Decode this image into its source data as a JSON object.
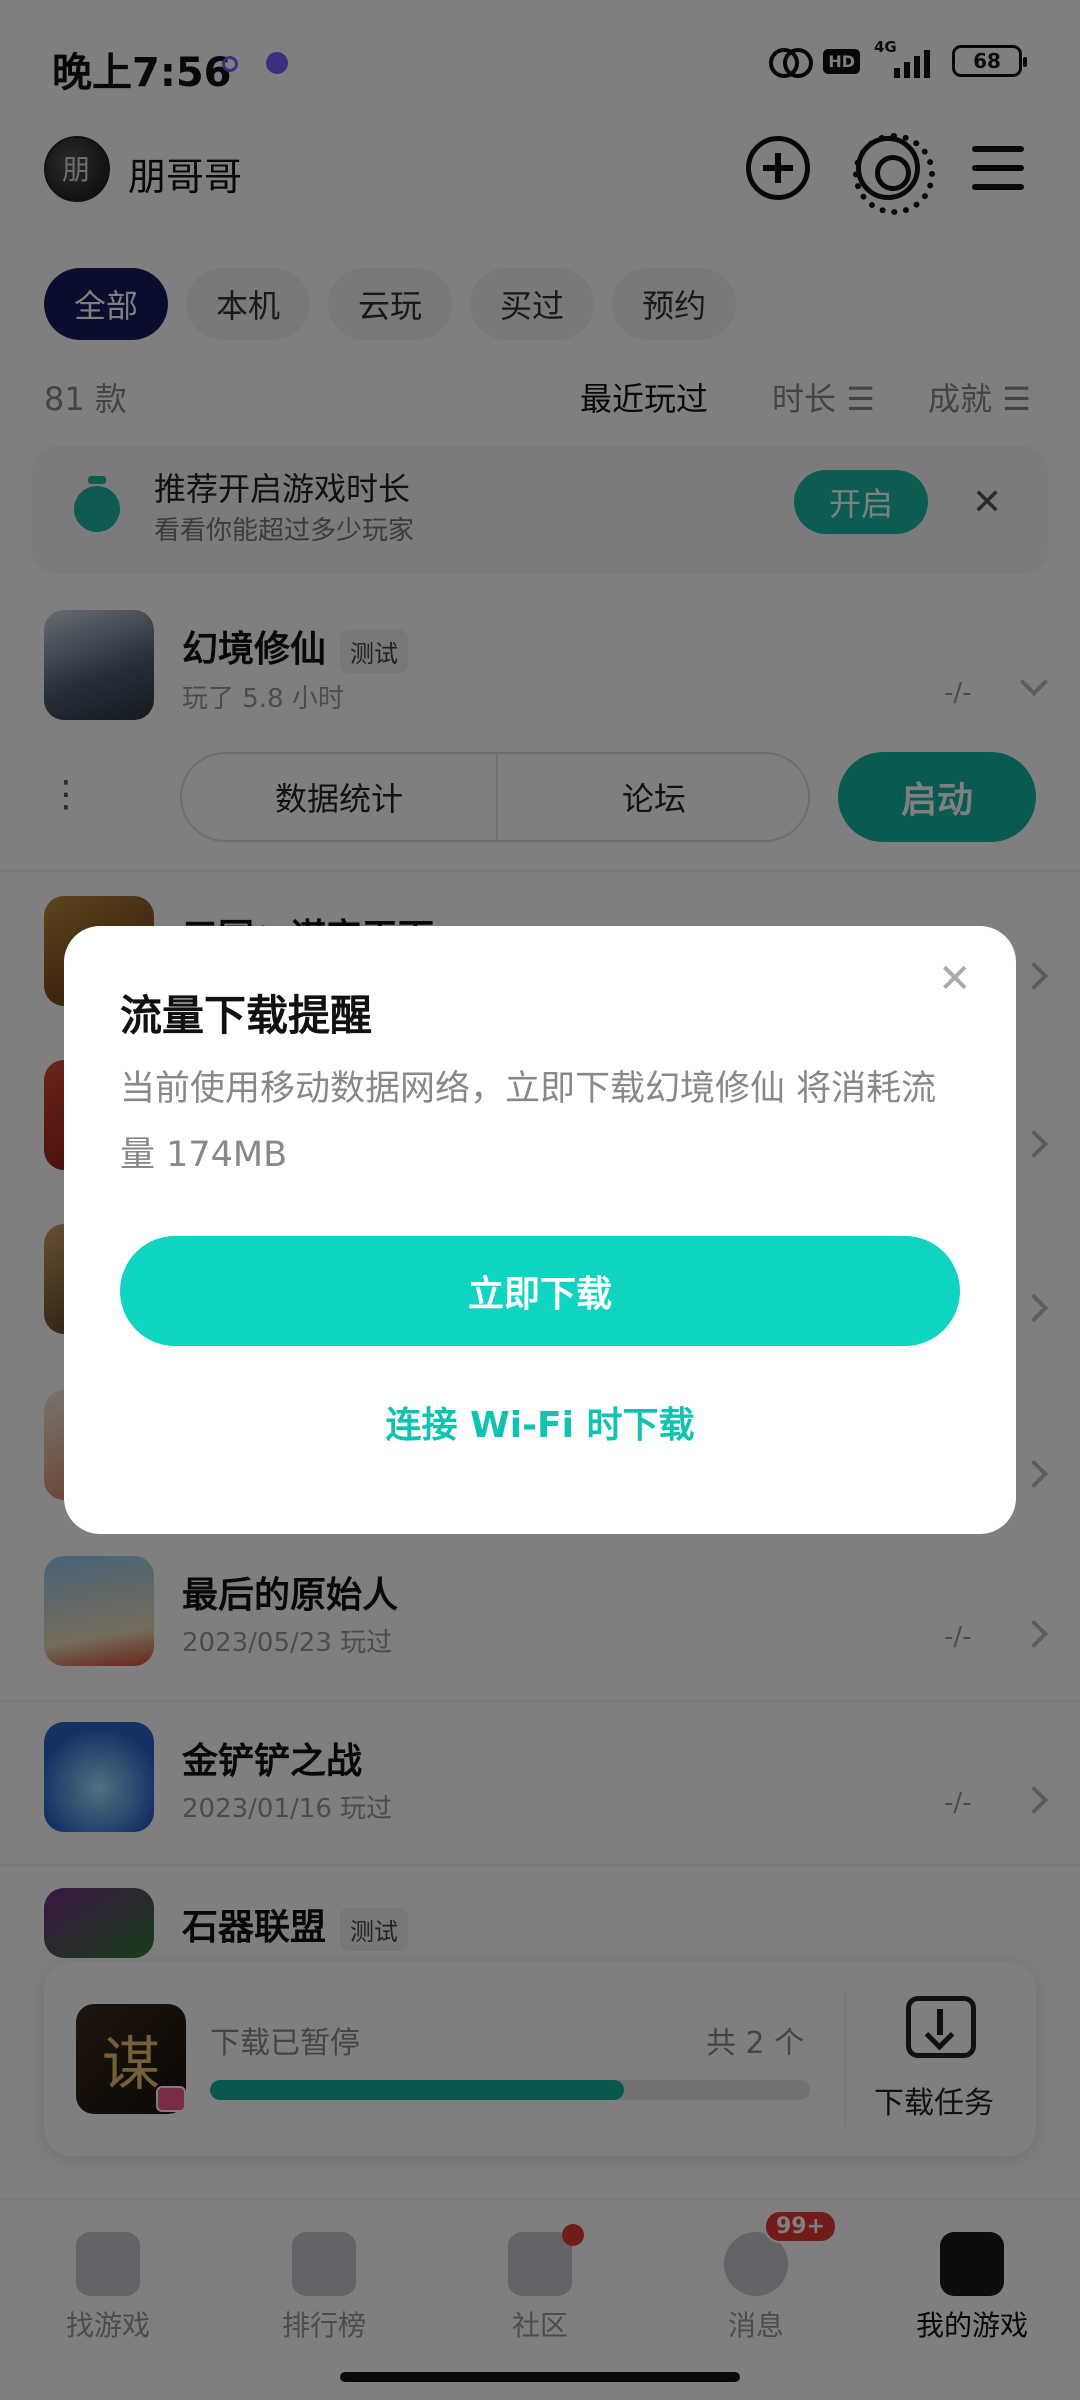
{
  "status_bar": {
    "time": "晚上7:56",
    "hd": "HD",
    "network": "4G",
    "battery": "68"
  },
  "header": {
    "username": "朋哥哥",
    "avatar_text": "朋"
  },
  "filters": [
    "全部",
    "本机",
    "云玩",
    "买过",
    "预约"
  ],
  "sort": {
    "count": "81 款",
    "options": [
      "最近玩过",
      "时长",
      "成就"
    ]
  },
  "tip": {
    "title": "推荐开启游戏时长",
    "subtitle": "看看你能超过多少玩家",
    "button": "开启"
  },
  "games": [
    {
      "name": "幻境修仙",
      "tag": "测试",
      "sub": "玩了 5.8 小时",
      "meta": "-/-"
    },
    {
      "name": "三国：谋定天下",
      "tag": "",
      "sub": "",
      "meta": ""
    },
    {
      "name": "最后的原始人",
      "tag": "",
      "sub": "2023/05/23 玩过",
      "meta": "-/-"
    },
    {
      "name": "金铲铲之战",
      "tag": "",
      "sub": "2023/01/16 玩过",
      "meta": "-/-"
    },
    {
      "name": "石器联盟",
      "tag": "测试",
      "sub": "",
      "meta": ""
    }
  ],
  "actions": {
    "stats": "数据统计",
    "forum": "论坛",
    "launch": "启动"
  },
  "download": {
    "status": "下载已暂停",
    "count": "共 2 个",
    "progress": 0.69,
    "task_label": "下载任务",
    "icon_text": "谋"
  },
  "nav": {
    "items": [
      "找游戏",
      "排行榜",
      "社区",
      "消息",
      "我的游戏"
    ],
    "message_badge": "99+"
  },
  "dialog": {
    "title": "流量下载提醒",
    "body": "当前使用移动数据网络，立即下载幻境修仙 将消耗流量 174MB",
    "primary": "立即下载",
    "secondary": "连接 Wi-Fi 时下载"
  },
  "colors": {
    "accent": "#13b5a0",
    "dialog_button": "#0fd4c2",
    "active_chip": "#161a5e"
  }
}
